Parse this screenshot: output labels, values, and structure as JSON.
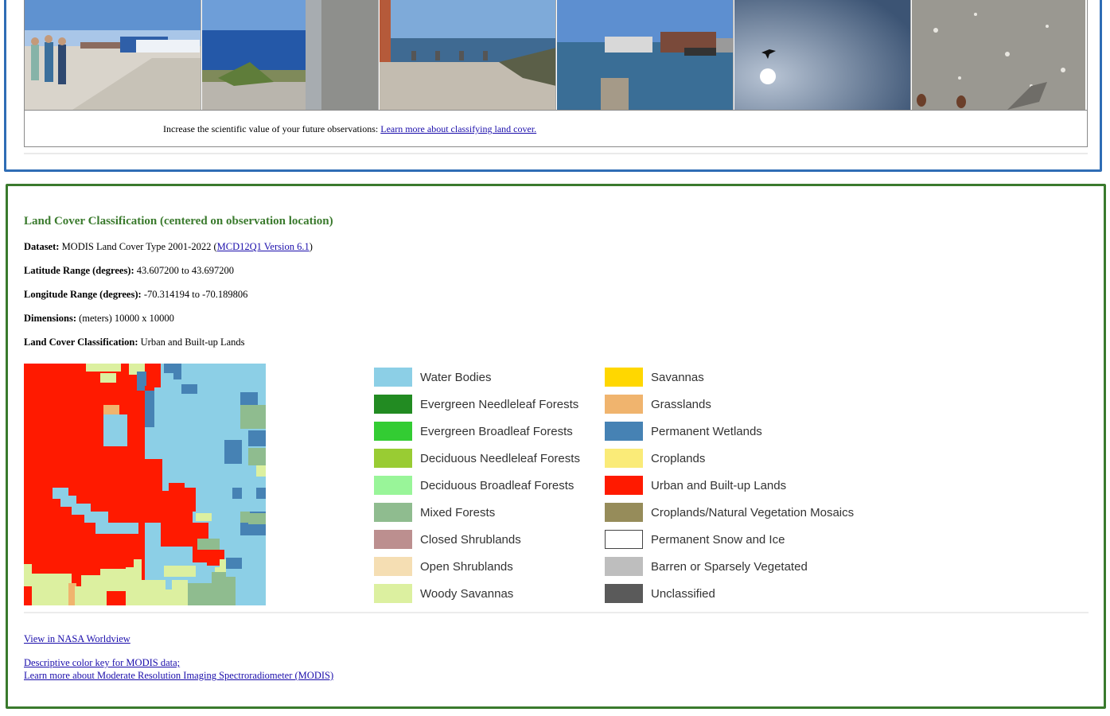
{
  "observation": {
    "caption_text": "Increase the scientific value of your future observations: ",
    "caption_link": "Learn more about classifying land cover."
  },
  "land_cover": {
    "title": "Land Cover Classification (centered on observation location)",
    "dataset_label": "Dataset:",
    "dataset_value": "MODIS Land Cover Type 2001-2022 (",
    "dataset_link": "MCD12Q1 Version 6.1",
    "dataset_close": ")",
    "lat_label": "Latitude Range (degrees):",
    "lat_value": "43.607200 to 43.697200",
    "lon_label": "Longitude Range (degrees):",
    "lon_value": "-70.314194 to -70.189806",
    "dim_label": "Dimensions:",
    "dim_value": "(meters) 10000 x 10000",
    "class_label": "Land Cover Classification:",
    "class_value": "Urban and Built-up Lands",
    "legend_left": [
      {
        "label": "Water Bodies",
        "color": "#8ccfe6"
      },
      {
        "label": "Evergreen Needleleaf Forests",
        "color": "#228b22"
      },
      {
        "label": "Evergreen Broadleaf Forests",
        "color": "#33cc33"
      },
      {
        "label": "Deciduous Needleleaf Forests",
        "color": "#99cc33"
      },
      {
        "label": "Deciduous Broadleaf Forests",
        "color": "#99f599"
      },
      {
        "label": "Mixed Forests",
        "color": "#8fbc8f"
      },
      {
        "label": "Closed Shrublands",
        "color": "#bc8f8f"
      },
      {
        "label": "Open Shrublands",
        "color": "#f5deb3"
      },
      {
        "label": "Woody Savannas",
        "color": "#dcf0a0"
      }
    ],
    "legend_right": [
      {
        "label": "Savannas",
        "color": "#ffd700"
      },
      {
        "label": "Grasslands",
        "color": "#f0b46e"
      },
      {
        "label": "Permanent Wetlands",
        "color": "#4682b4"
      },
      {
        "label": "Croplands",
        "color": "#faeb78"
      },
      {
        "label": "Urban and Built-up Lands",
        "color": "#ff1a00"
      },
      {
        "label": "Croplands/Natural Vegetation Mosaics",
        "color": "#968c5a"
      },
      {
        "label": "Permanent Snow and Ice",
        "color": "#ffffff"
      },
      {
        "label": "Barren or Sparsely Vegetated",
        "color": "#bebebe"
      },
      {
        "label": "Unclassified",
        "color": "#5a5a5a"
      }
    ],
    "links": {
      "worldview": "View in NASA Worldview",
      "color_key": "Descriptive color key for MODIS data;",
      "modis": "Learn more about Moderate Resolution Imaging Spectroradiometer (MODIS)"
    }
  }
}
